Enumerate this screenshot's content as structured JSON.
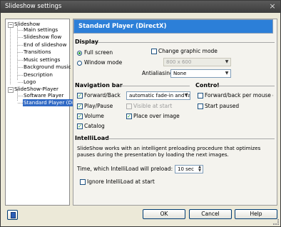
{
  "window": {
    "title": "Slideshow settings",
    "close": "×"
  },
  "tree": {
    "root1": "Slideshow",
    "root1_items": [
      "Main settings",
      "Slideshow flow",
      "End of slideshow",
      "Transitions",
      "Music settings",
      "Background music",
      "Description",
      "Logo"
    ],
    "root2": "SlideShow-Player",
    "root2_items": [
      "Software Player",
      "Standard Player (Di..."
    ],
    "selected": "Standard Player (Di..."
  },
  "banner": "Standard Player (DirectX)",
  "display": {
    "header": "Display",
    "fullscreen_label": "Full screen",
    "fullscreen_selected": true,
    "window_label": "Window mode",
    "change_graphic_label": "Change graphic mode",
    "resolution_value": "800 x 600",
    "antialiasing_label": "Antialiasing:",
    "antialiasing_value": "None"
  },
  "navbar": {
    "header": "Navigation bar",
    "forward_back_label": "Forward/Back",
    "transition_value": "automatic fade-in and fade-",
    "play_pause_label": "Play/Pause",
    "visible_start_label": "Visible at start",
    "volume_label": "Volume",
    "place_over_label": "Place over image",
    "catalog_label": "Catalog"
  },
  "control": {
    "header": "Control",
    "mouse_click_label": "Forward/back per mouse click",
    "start_paused_label": "Start paused"
  },
  "intelliload": {
    "header": "IntelliLoad",
    "description": "SlideShow works with an intelligent preloading procedure that optimizes pauses during the presentation by loading the next images.",
    "time_label": "Time, which IntelliLoad will preload:",
    "time_value": "10 sec",
    "ignore_label": "Ignore IntelliLoad at start"
  },
  "buttons": {
    "ok": "OK",
    "cancel": "Cancel",
    "help": "Help"
  }
}
